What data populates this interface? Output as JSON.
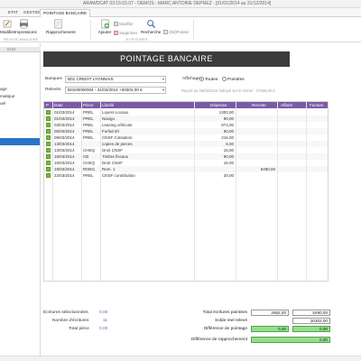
{
  "window": {
    "title": "ARAWDCAT 03:15:03.07 - DEMOS - MARC ANTOINE DEPREZ - [01/01/2014 au 31/12/2014]"
  },
  "tabs": [
    {
      "label": "ETAT"
    },
    {
      "label": "GESTION"
    },
    {
      "label": "POINTAGE BANCAIRE"
    }
  ],
  "ribbon": {
    "first_btn_top": "Modifier",
    "first_btn_bottom": "Supprimer",
    "impressions": "Impressions",
    "rapprochement": "Rapprochement",
    "ajouter": "Ajouter",
    "modifier": "Modifier",
    "supprimer": "Supprimer",
    "recherche": "Recherche",
    "pointer": "(Dé)Pointer",
    "group_left": "RELEVE BANCAIRE",
    "group_right": "ECRITURES"
  },
  "leftpanel": {
    "header": "ETAT",
    "items": [
      "age",
      "matique",
      "uel"
    ]
  },
  "main": {
    "title": "POINTAGE BANCAIRE",
    "banques_label": "Banques",
    "banque_value": "B01 CREDIT LYONNAIS",
    "releves_label": "Relevés",
    "releve_value": "B0100000004 - 31/03/2014 +30302,00 €",
    "affichage_label": "Affichage",
    "radio_toutes": "Toutes",
    "radio_pointees": "Pointées",
    "report_note": "Report au 28/02/2014 indiqué sur le relevé : 27458,00 €"
  },
  "table": {
    "headers": [
      "P",
      "Date",
      "Pièce",
      "Libellé",
      "Dépense",
      "Recette",
      "Affaire",
      "Facture"
    ],
    "rows": [
      {
        "date": "01/03/2014",
        "piece": "PREL",
        "libelle": "Loyers Locaux",
        "depense": "1300,00",
        "recette": ""
      },
      {
        "date": "01/03/2014",
        "piece": "PREL",
        "libelle": "Navigo",
        "depense": "90,00",
        "recette": ""
      },
      {
        "date": "03/03/2014",
        "piece": "PREL",
        "libelle": "Leasing véhicule",
        "depense": "874,00",
        "recette": ""
      },
      {
        "date": "05/03/2014",
        "piece": "PREL",
        "libelle": "Forfait tél",
        "depense": "90,00",
        "recette": ""
      },
      {
        "date": "09/03/2014",
        "piece": "PREL",
        "libelle": "CNSF Cotisation",
        "depense": "216,00",
        "recette": ""
      },
      {
        "date": "13/03/2014",
        "piece": "",
        "libelle": "copies de pieces",
        "depense": "6,00",
        "recette": ""
      },
      {
        "date": "13/03/2014",
        "piece": "CHEQ",
        "libelle": "Droit CNSF",
        "depense": "15,00",
        "recette": ""
      },
      {
        "date": "16/03/2014",
        "piece": "CB",
        "libelle": "Timbre fiscaux",
        "depense": "90,00",
        "recette": ""
      },
      {
        "date": "16/03/2014",
        "piece": "CHEQ",
        "libelle": "Droit CNSF",
        "depense": "15,00",
        "recette": ""
      },
      {
        "date": "18/03/2014",
        "piece": "R0001",
        "libelle": "Rem. 1",
        "depense": "",
        "recette": "5490,00"
      },
      {
        "date": "22/03/2014",
        "piece": "PREL",
        "libelle": "CNSF contribution",
        "depense": "20,00",
        "recette": ""
      }
    ]
  },
  "footer": {
    "ecritures_sel_label": "Ecritures sélectionnées",
    "ecritures_sel_value": "0,00",
    "nb_ecritures_label": "Nombre d'écritures",
    "nb_ecritures_value": "11",
    "total_piece_label": "Total pièce",
    "total_piece_value": "0,00",
    "total_pointees_label": "Total écritures pointées",
    "total_pointees_dep": "2652,00",
    "total_pointees_rec": "5490,00",
    "solde_label": "Solde réel relevé",
    "solde_value": "30302,00",
    "diff_pointage_label": "Différence de pointage",
    "diff_pointage_dep": "0,00",
    "diff_pointage_rec": "0,00",
    "diff_rapp_label": "Différence de rapprochement",
    "diff_rapp_value": "0,00"
  },
  "colors": {
    "accent": "#7b5aa6",
    "header_dark": "#3c3c3c",
    "check_green": "#7cbb3a",
    "box_green": "#92e08a",
    "selection_blue": "#2a73c8"
  }
}
